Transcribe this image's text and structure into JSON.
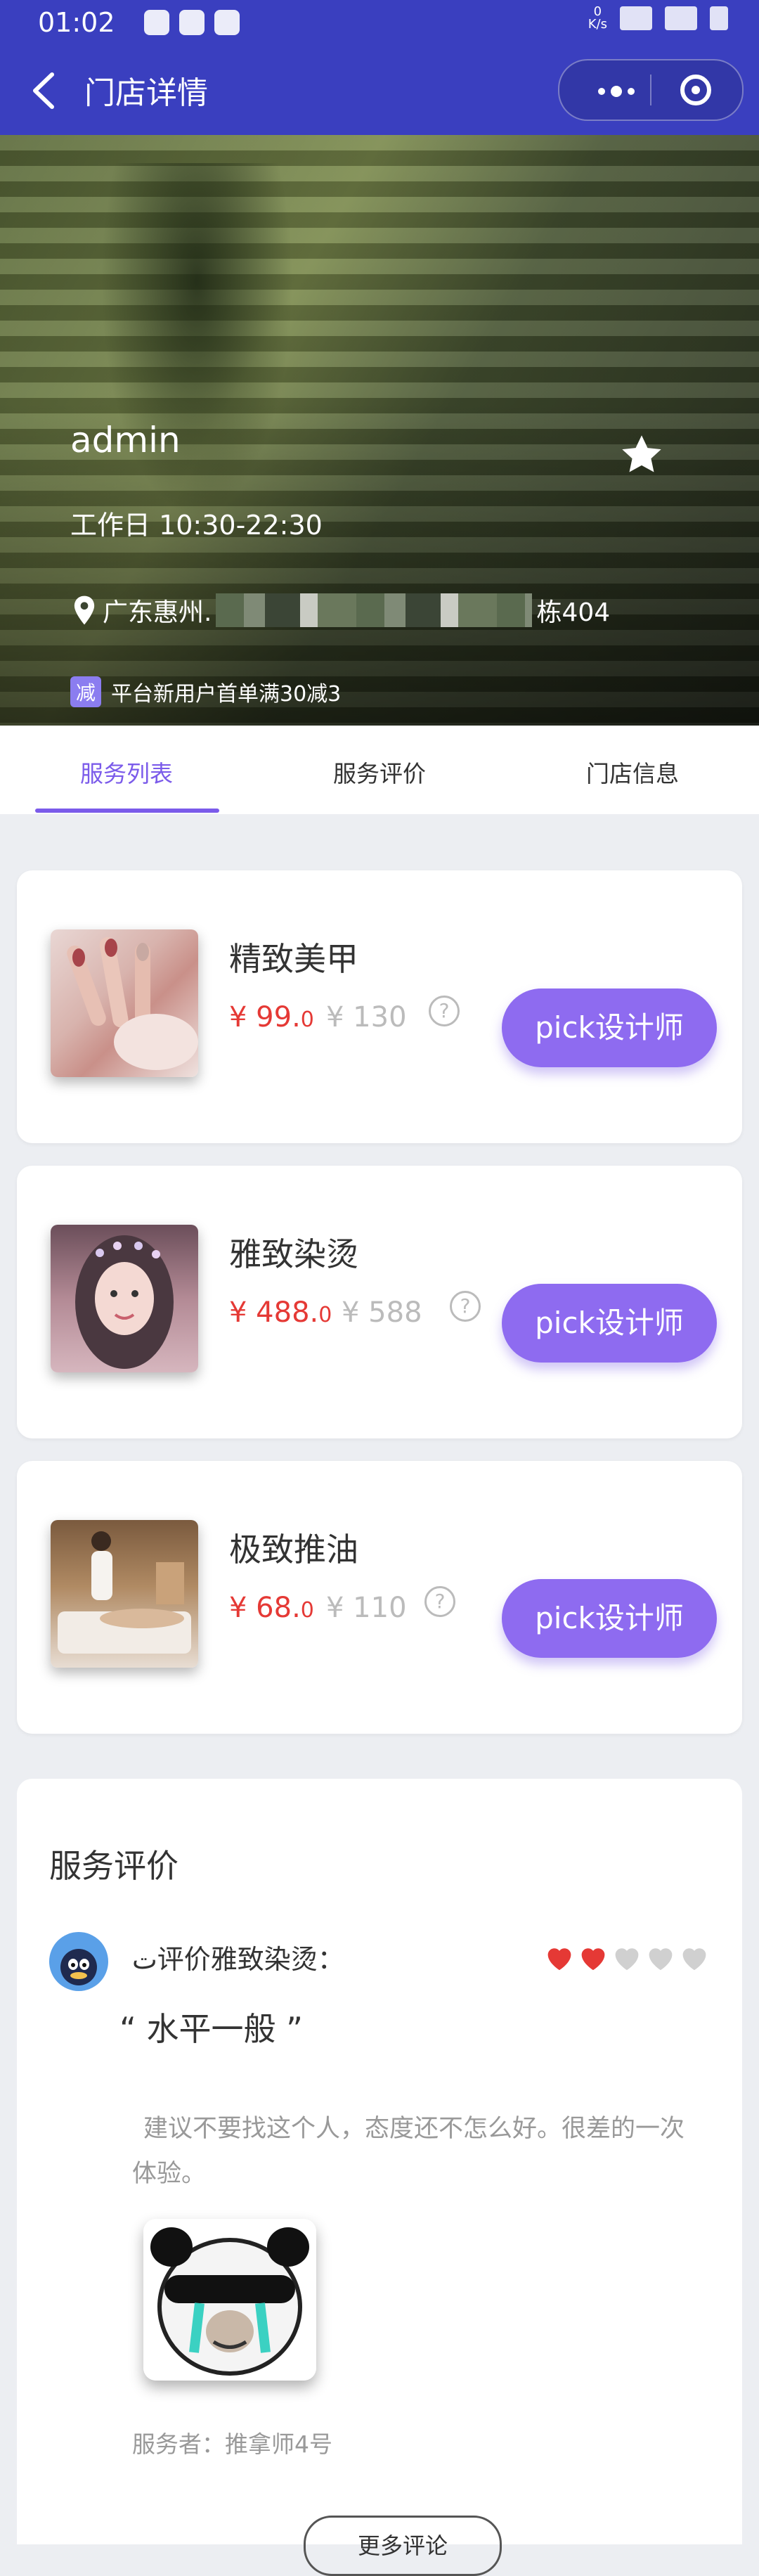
{
  "status_bar": {
    "time": "01:02",
    "net_speed": "0\nK/s",
    "signal": "4G"
  },
  "nav": {
    "title": "门店详情"
  },
  "store": {
    "name": "admin",
    "hours": "工作日 10:30-22:30",
    "address_prefix": "广东惠州.",
    "address_suffix": "栋404",
    "promo_tag": "减",
    "promo_text": "平台新用户首单满30减3"
  },
  "tabs": [
    {
      "label": "服务列表",
      "active": true
    },
    {
      "label": "服务评价",
      "active": false
    },
    {
      "label": "门店信息",
      "active": false
    }
  ],
  "services": [
    {
      "name": "精致美甲",
      "price_int": "¥ 99.",
      "price_dec": "0",
      "original": "¥ 130",
      "button": "pick设计师"
    },
    {
      "name": "雅致染烫",
      "price_int": "¥ 488.",
      "price_dec": "0",
      "original": "¥ 588",
      "button": "pick设计师"
    },
    {
      "name": "极致推油",
      "price_int": "¥ 68.",
      "price_dec": "0",
      "original": "¥ 110",
      "button": "pick设计师"
    }
  ],
  "review": {
    "section_title": "服务评价",
    "reviewer_line": "ت评价雅致染烫：",
    "rating": 2,
    "rating_max": 5,
    "headline": "“ 水平一般 ”",
    "body": "建议不要找这个人，态度还不怎么好。很差的一次体验。",
    "server": "服务者：推拿师4号",
    "more_button": "更多评论"
  },
  "colors": {
    "nav": "#3a3fbf",
    "accent": "#7b5bea",
    "button": "#8e6bf0",
    "price": "#e53935",
    "heart": "#e53935"
  }
}
